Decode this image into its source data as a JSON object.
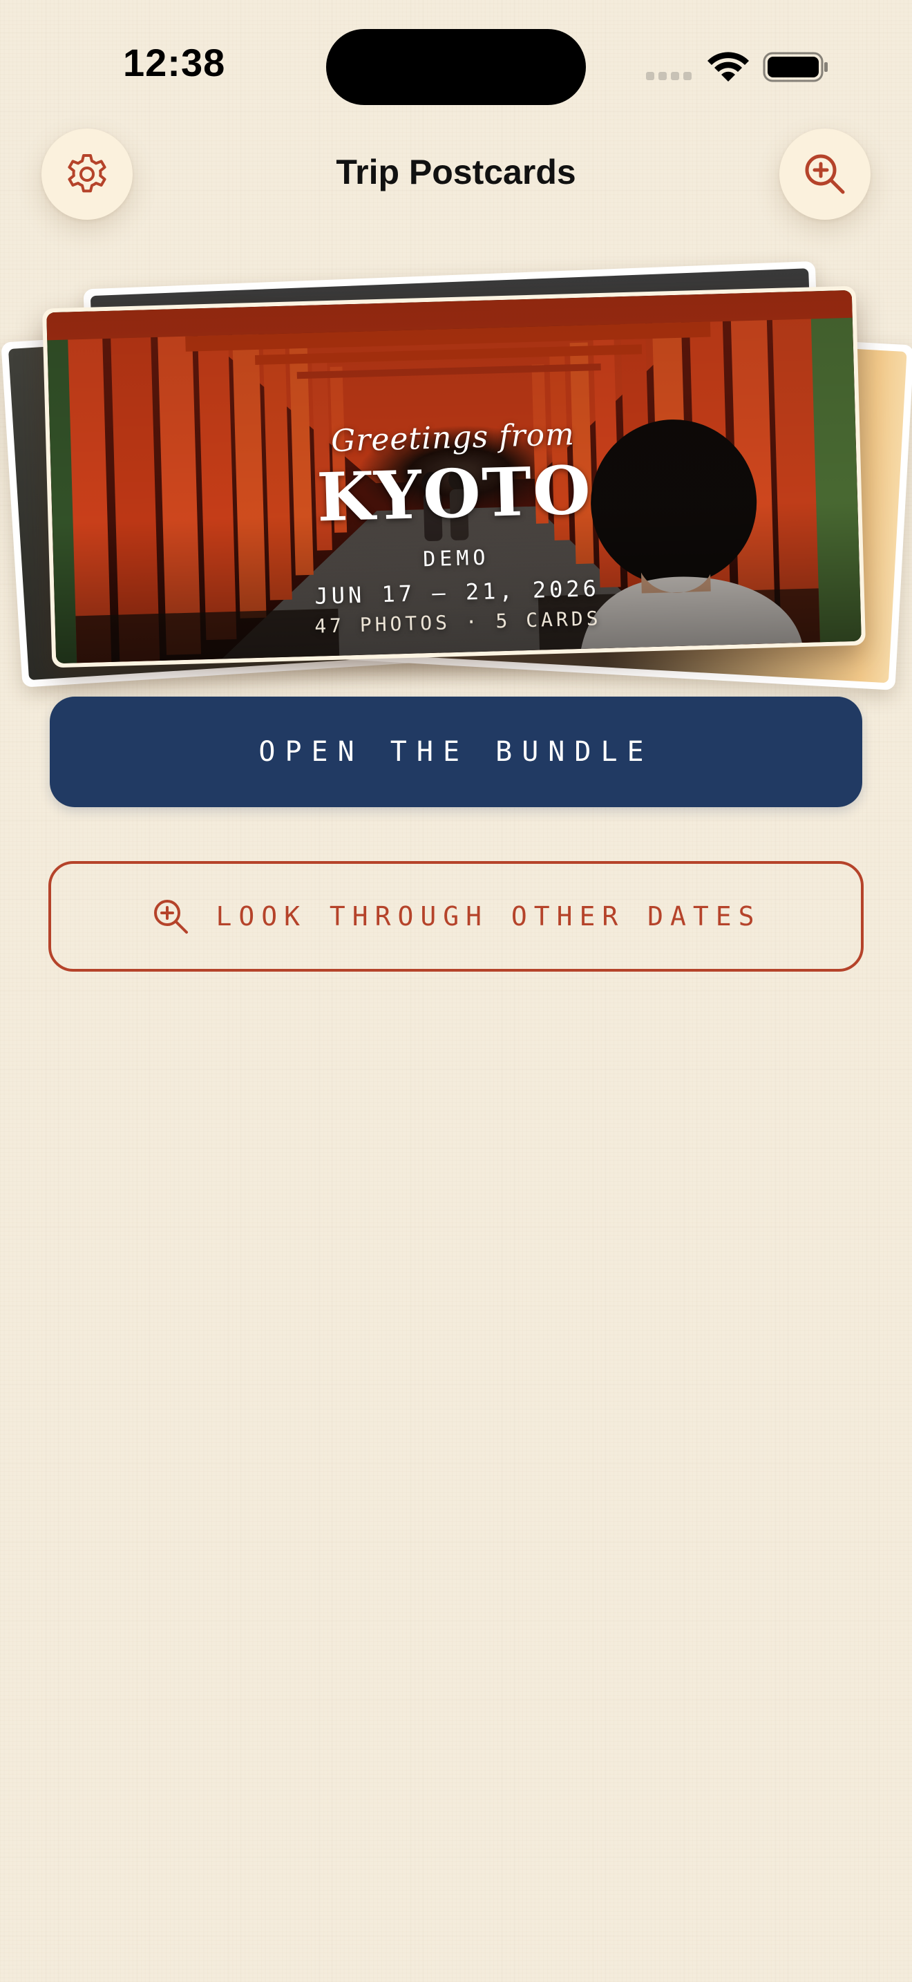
{
  "status_bar": {
    "time": "12:38"
  },
  "header": {
    "title": "Trip Postcards",
    "left_icon": "gear-icon",
    "right_icon": "zoom-in-icon"
  },
  "postcard": {
    "greeting": "Greetings from",
    "city": "KYOTO",
    "tag": "DEMO",
    "dates": "JUN 17 — 21, 2026",
    "counts": "47 PHOTOS · 5 CARDS"
  },
  "actions": {
    "primary_label": "OPEN THE BUNDLE",
    "secondary_label": "LOOK THROUGH OTHER DATES",
    "secondary_icon": "zoom-in-icon"
  },
  "colors": {
    "background": "#f4ecdc",
    "accent": "#b5432a",
    "primary": "#213a63",
    "round_button": "#fbf1dd"
  }
}
